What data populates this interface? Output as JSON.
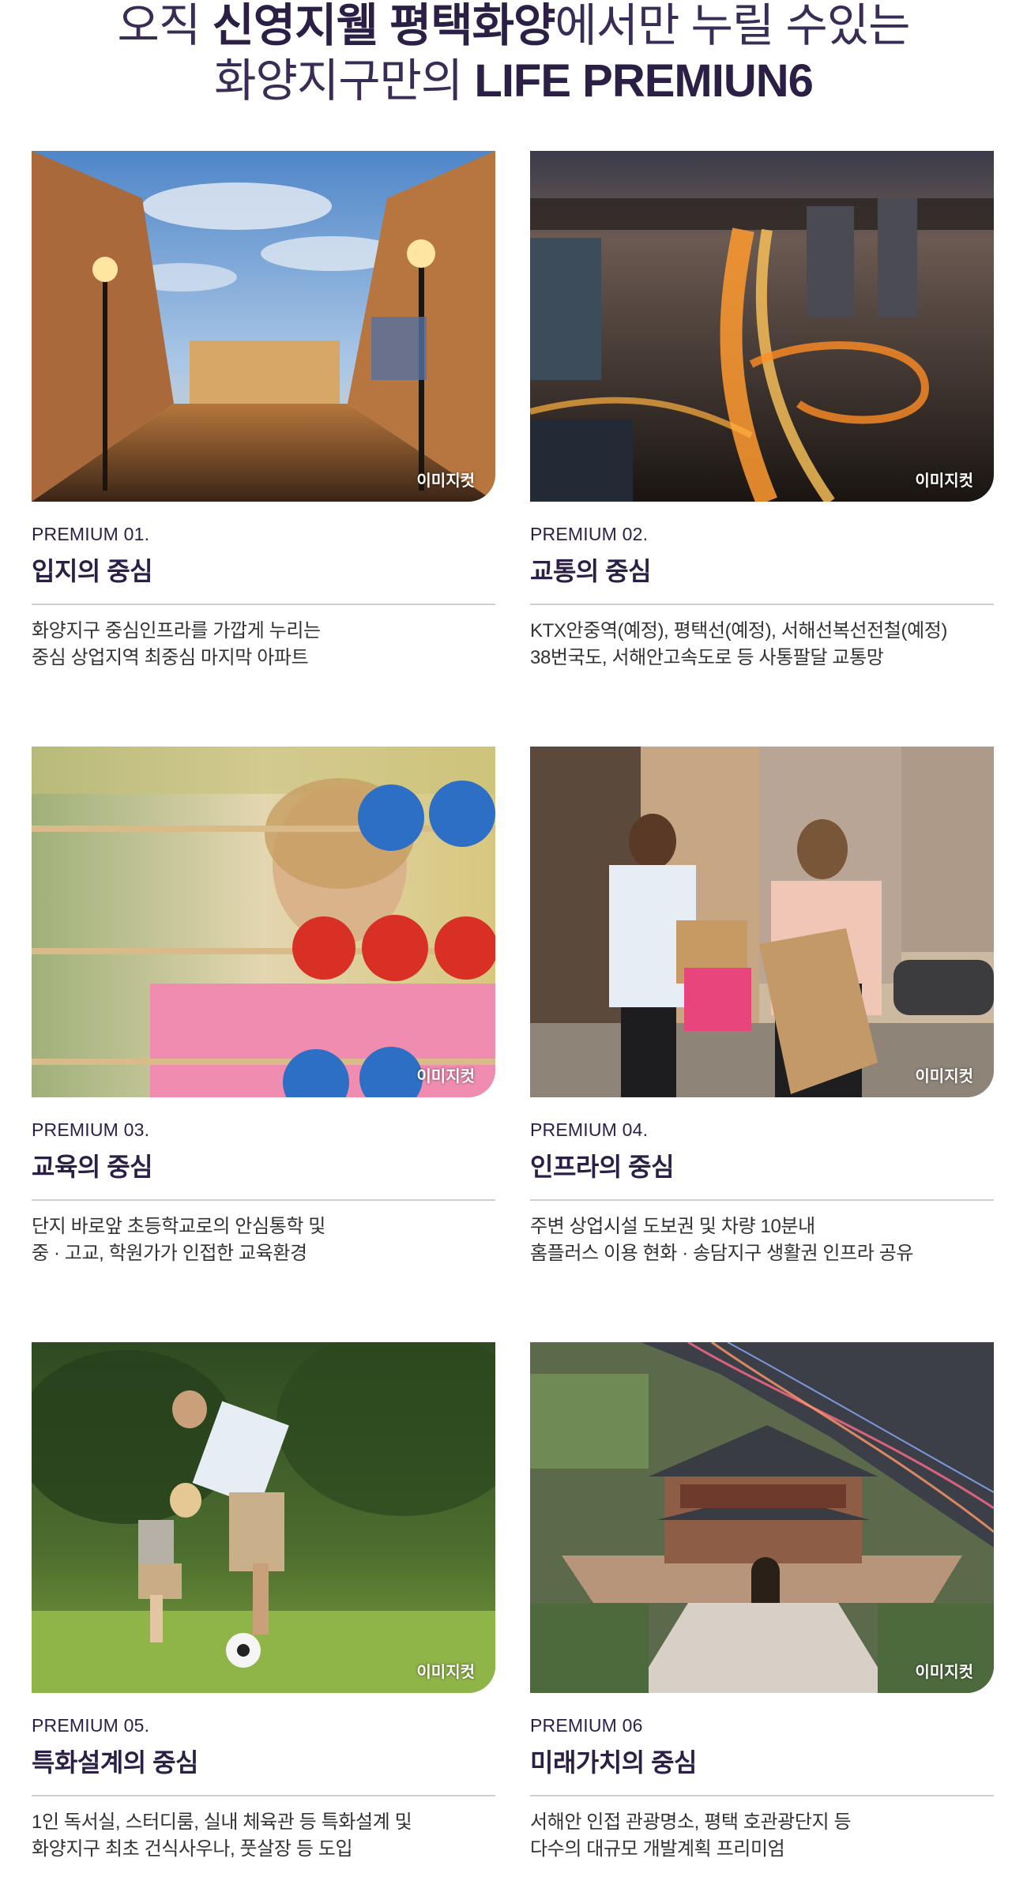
{
  "heading": {
    "line1_light1": "오직 ",
    "line1_bold": "신영지웰 평택화양",
    "line1_light2": "에서만 누릴 수있는",
    "line2_light": "화양지구만의 ",
    "line2_bold": "LIFE PREMIUN6"
  },
  "watermark": "이미지컷",
  "cards": [
    {
      "label": "PREMIUM 01.",
      "title": "입지의 중심",
      "desc1": "화양지구 중심인프라를 가깝게 누리는",
      "desc2": "중심 상업지역 최중심 마지막 아파트",
      "image": "venetian-plaza-photo"
    },
    {
      "label": "PREMIUM 02.",
      "title": "교통의 중심",
      "desc1": "KTX안중역(예정), 평택선(예정), 서해선복선전철(예정)",
      "desc2": "38번국도, 서해안고속도로 등 사통팔달 교통망",
      "image": "night-highway-photo"
    },
    {
      "label": "PREMIUM 03.",
      "title": "교육의 중심",
      "desc1": "단지 바로앞 초등학교로의 안심통학 및",
      "desc2": "중 · 고교, 학원가가 인접한 교육환경",
      "image": "child-abacus-photo"
    },
    {
      "label": "PREMIUM 04.",
      "title": "인프라의 중심",
      "desc1": "주변 상업시설 도보권 및 차량 10분내",
      "desc2": "홈플러스 이용 현화 · 송담지구 생활권 인프라 공유",
      "image": "shopping-street-photo"
    },
    {
      "label": "PREMIUM 05.",
      "title": "특화설계의 중심",
      "desc1": "1인 독서실, 스터디룸, 실내 체육관 등 특화설계 및",
      "desc2": "화양지구 최초 건식사우나, 풋살장 등 도입",
      "image": "father-son-soccer-photo"
    },
    {
      "label": "PREMIUM 06",
      "title": "미래가치의 중심",
      "desc1": "서해안 인접 관광명소, 평택 호관광단지 등",
      "desc2": "다수의 대규모 개발계획 프리미엄",
      "image": "city-gate-photo"
    }
  ]
}
